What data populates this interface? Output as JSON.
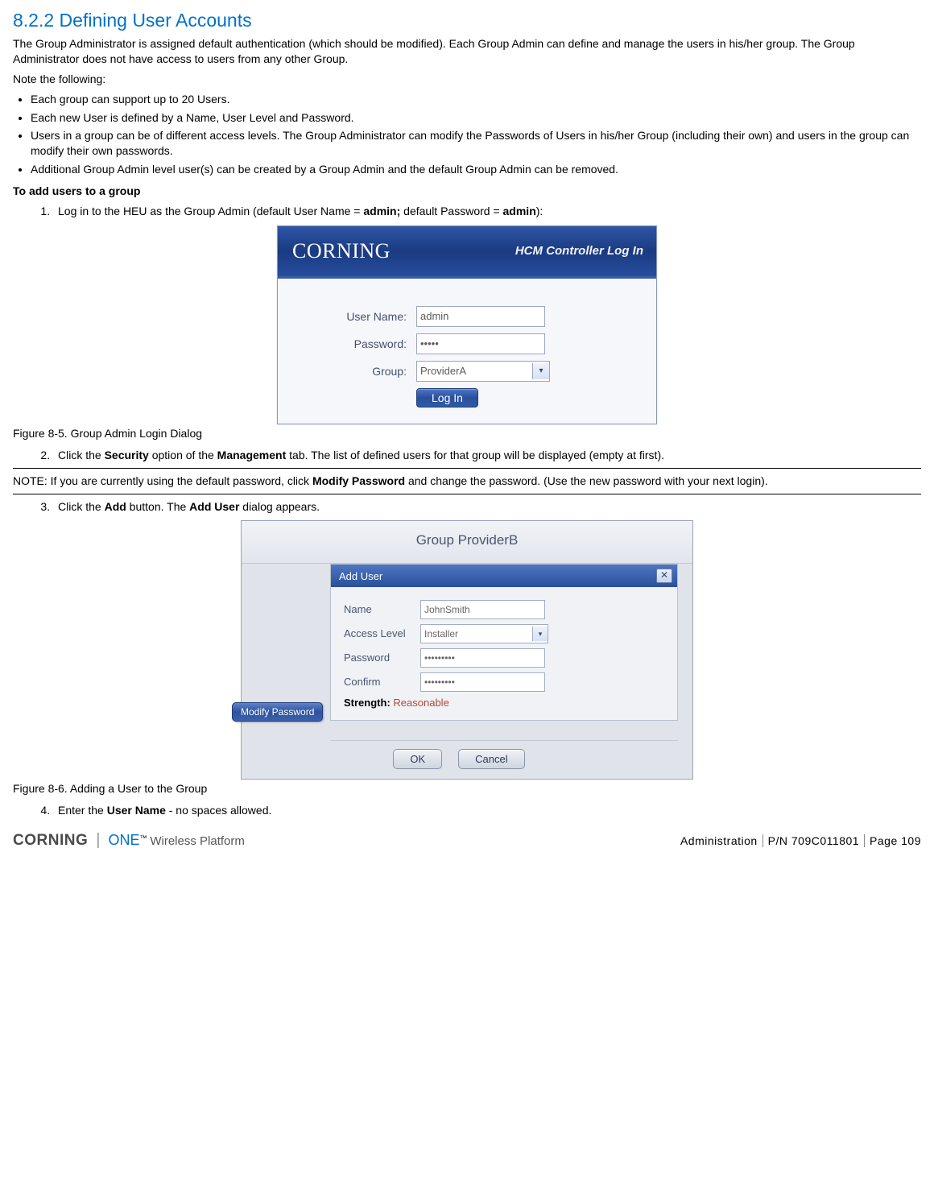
{
  "heading": "8.2.2 Defining User Accounts",
  "intro1": "The Group Administrator is assigned default authentication (which should be modified). Each Group Admin can define and manage the users in his/her group. The Group Administrator does not have access to users from any other Group.",
  "intro2": "Note the following:",
  "bullets": [
    "Each group can support up to 20 Users.",
    "Each new User is defined by a Name, User Level and Password.",
    "Users in a group can be of different access levels. The Group Administrator can modify the Passwords of Users in his/her Group (including their own) and users in the group can modify their own passwords.",
    "Additional Group Admin level user(s) can be created by a Group Admin and the default Group Admin can be removed."
  ],
  "procTitle": "To add users to a group",
  "steps": {
    "s1_pre": "Log in to the HEU as the Group Admin (default User Name = ",
    "s1_b1": "admin;",
    "s1_mid": " default Password = ",
    "s1_b2": "admin",
    "s1_post": "):",
    "s2_pre": "Click the ",
    "s2_b1": "Security",
    "s2_mid": " option of the ",
    "s2_b2": "Management",
    "s2_post": " tab. The list of defined users for that group will be displayed (empty at first).",
    "s3_pre": "Click the ",
    "s3_b1": "Add",
    "s3_mid": " button. The ",
    "s3_b2": "Add User",
    "s3_post": " dialog appears.",
    "s4_pre": "Enter the ",
    "s4_b1": "User Name",
    "s4_post": " - no spaces allowed."
  },
  "note_pre": "NOTE: If you are currently using the default password, click ",
  "note_b": "Modify Password",
  "note_post": " and change the password. (Use the new password with your next login).",
  "fig5_caption": "Figure 8-5. Group Admin Login Dialog",
  "fig6_caption": "Figure 8-6. Adding a User to the Group",
  "login": {
    "logo": "CORNING",
    "title": "HCM Controller Log In",
    "user_lbl": "User Name:",
    "user_val": "admin",
    "pass_lbl": "Password:",
    "pass_val": "•••••",
    "group_lbl": "Group:",
    "group_val": "ProviderA",
    "btn": "Log In"
  },
  "adduser": {
    "top": "Group ProviderB",
    "side_btn": "Modify Password",
    "title": "Add User",
    "name_lbl": "Name",
    "name_val": "JohnSmith",
    "level_lbl": "Access Level",
    "level_val": "Installer",
    "pass_lbl": "Password",
    "pass_val": "•••••••••",
    "conf_lbl": "Confirm",
    "conf_val": "•••••••••",
    "strength_lbl": "Strength:",
    "strength_val": "Reasonable",
    "ok": "OK",
    "cancel": "Cancel"
  },
  "footer": {
    "brand1": "CORNING",
    "brand2": "ONE",
    "brand3": "Wireless Platform",
    "section": "Administration",
    "pn": "P/N 709C011801",
    "page": "Page 109"
  }
}
